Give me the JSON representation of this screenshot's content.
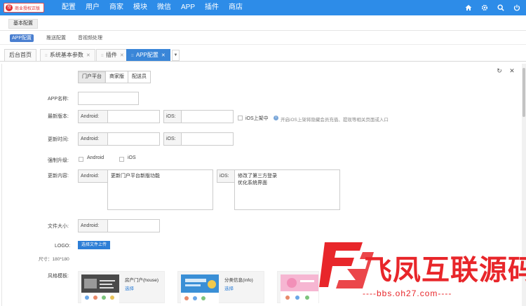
{
  "topbar": {
    "logo_text": "商业授权正版",
    "logo_mark": "授",
    "nav": [
      "配置",
      "用户",
      "商家",
      "模块",
      "微信",
      "APP",
      "插件",
      "商店"
    ],
    "icons": [
      "home-icon",
      "gear-icon",
      "search-icon",
      "power-icon"
    ]
  },
  "subheader": {
    "button": "基本配置"
  },
  "subnav": {
    "items": [
      "APP配置",
      "推送配置",
      "音视频处理"
    ],
    "active": 0
  },
  "tabs": {
    "items": [
      "后台首页",
      "系统基本参数",
      "插件",
      "APP配置"
    ],
    "active": 3
  },
  "panel": {
    "segments": [
      "门户平台",
      "商家版",
      "配送员"
    ],
    "active_segment": 0,
    "form": {
      "app_name_label": "APP名称:",
      "latest_version_label": "最新版本:",
      "update_time_label": "更新时间:",
      "force_upgrade_label": "强制升级:",
      "update_content_label": "更新内容:",
      "file_size_label": "文件大小:",
      "logo_label": "LOGO:",
      "logo_size": "尺寸：180*180",
      "style_label": "风格模板:",
      "android": "Android:",
      "ios": "iOS:",
      "ios_listing": "iOS上架中",
      "ios_hint": "开启iOS上架将隐藏会员充值、提现等相关页面或入口",
      "force_android": "Android",
      "force_ios": "iOS",
      "android_content": "更新门户平台新版功能",
      "ios_content": "修改了第三方登录\n优化系统界面",
      "upload_button": "选择文件上传",
      "templates": [
        {
          "name": "房产门户(house)",
          "select": "选择"
        },
        {
          "name": "分类信息(info)",
          "select": "选择"
        }
      ]
    }
  },
  "watermark": {
    "title": "飞凤互联源码",
    "url": "----bbs.oh27.com----",
    "color": "#e8262a"
  }
}
